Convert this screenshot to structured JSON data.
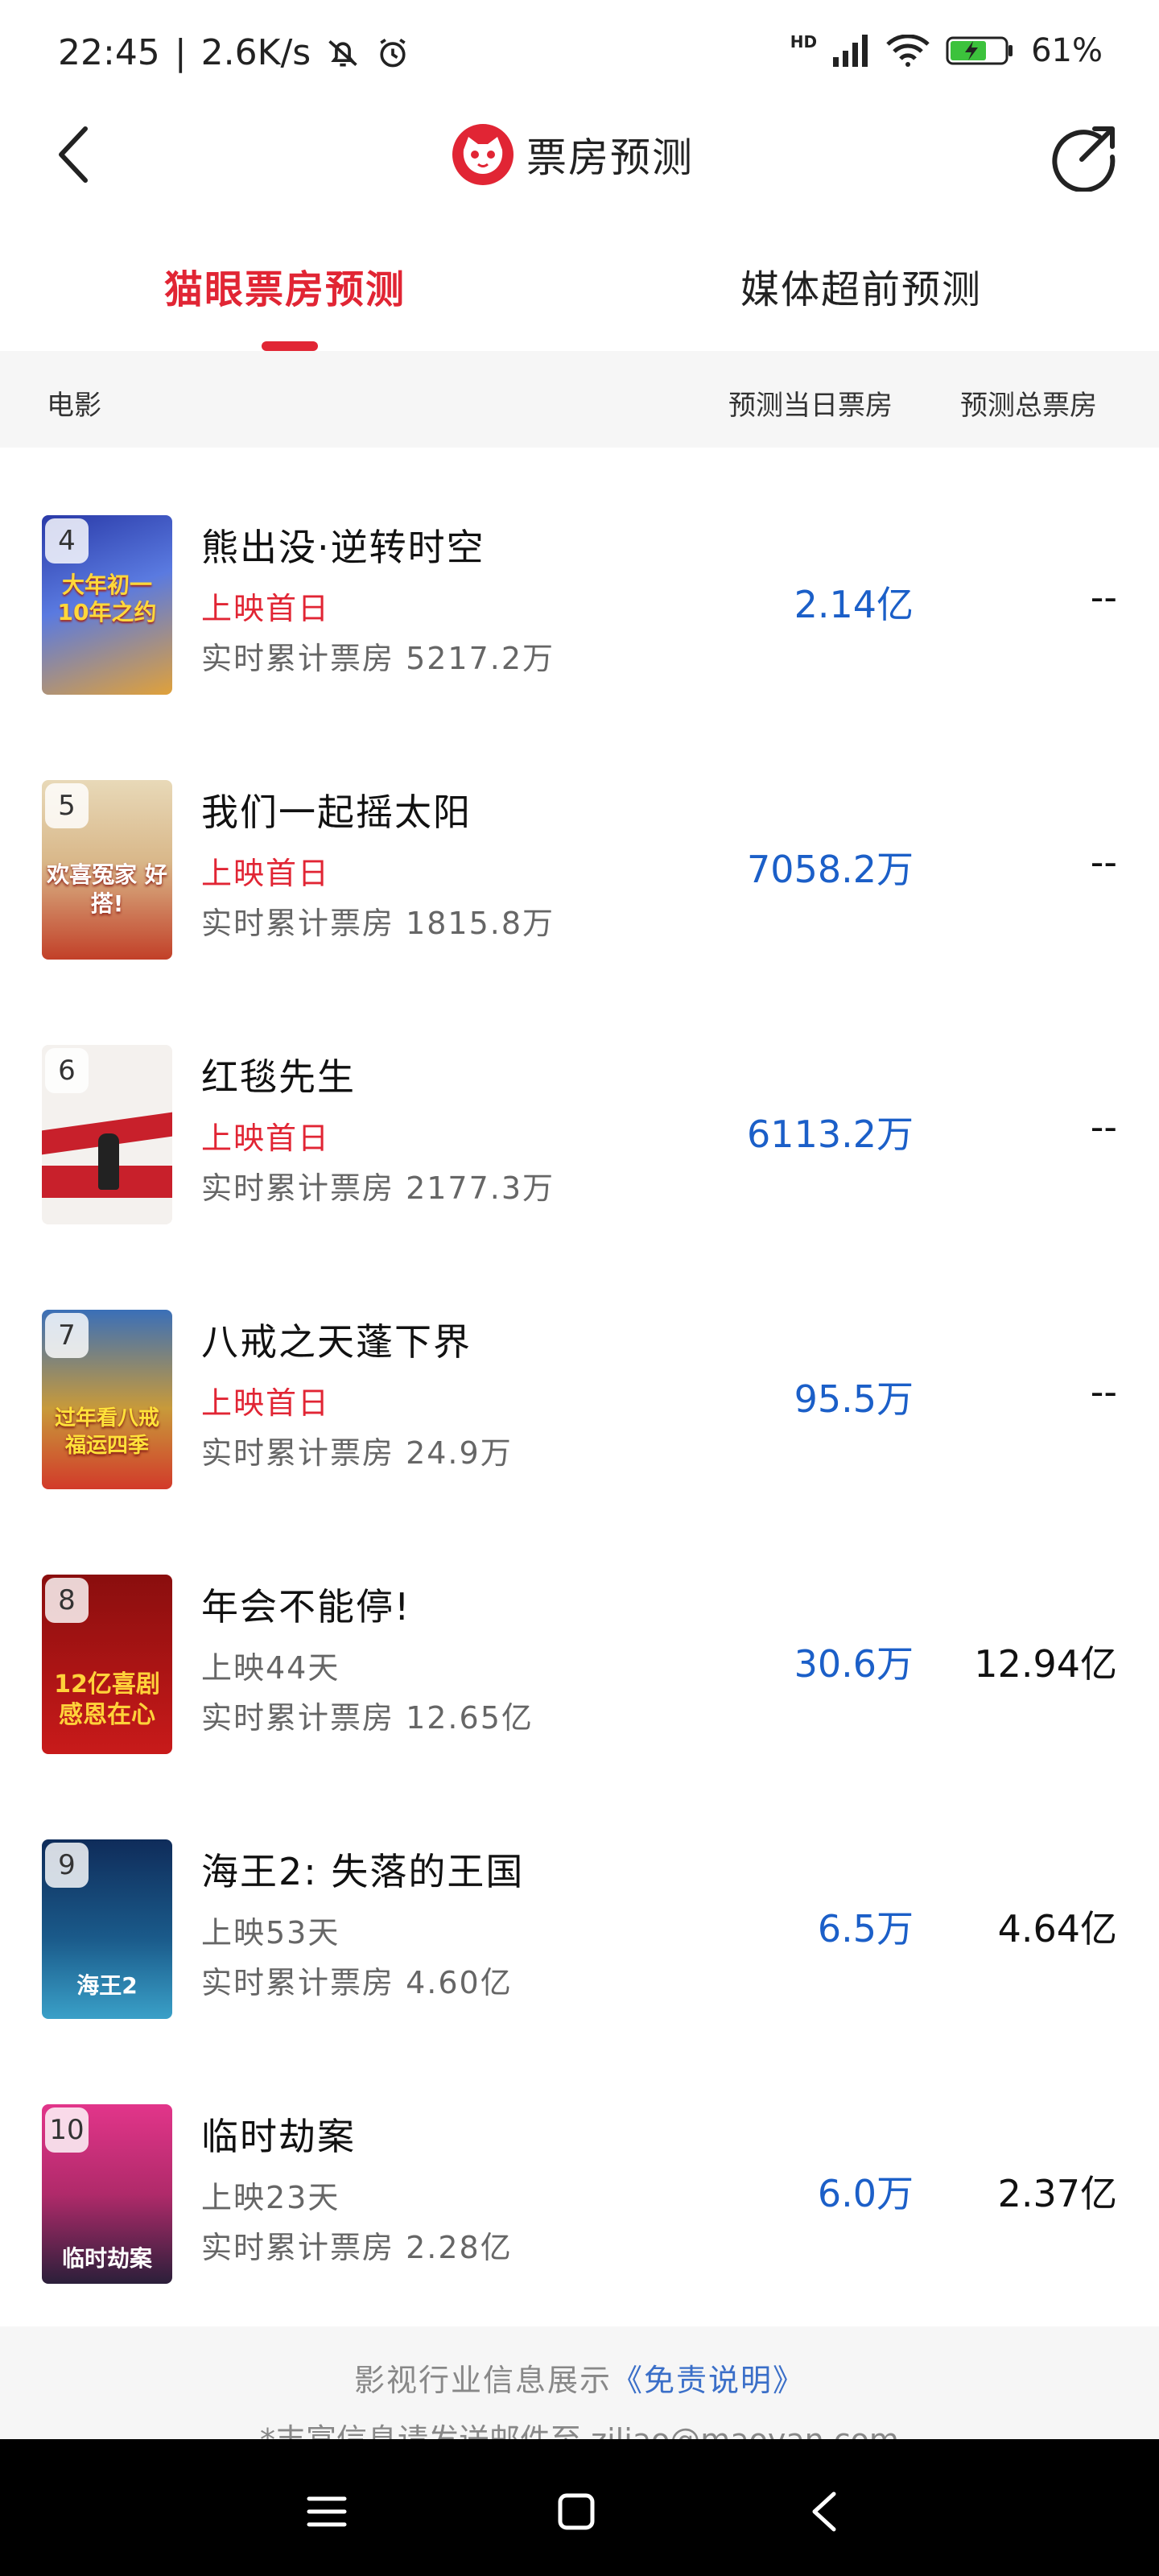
{
  "status_bar": {
    "time": "22:45",
    "divider": "|",
    "speed": "2.6K/s",
    "network": "HD",
    "battery": "61%"
  },
  "header": {
    "title": "票房预测"
  },
  "tabs": [
    {
      "label": "猫眼票房预测",
      "active": true
    },
    {
      "label": "媒体超前预测",
      "active": false
    }
  ],
  "table_header": {
    "movie": "电影",
    "day_forecast": "预测当日票房",
    "total_forecast": "预测总票房"
  },
  "movies": [
    {
      "rank": "4",
      "name": "熊出没·逆转时空",
      "release": "上映首日",
      "cumulative": "实时累计票房 5217.2万",
      "day": "2.14亿",
      "total": "--",
      "poster_colors": [
        "#2a3aa8",
        "#e0a13a"
      ]
    },
    {
      "rank": "5",
      "name": "我们一起摇太阳",
      "release": "上映首日",
      "cumulative": "实时累计票房 1815.8万",
      "day": "7058.2万",
      "total": "--",
      "poster_colors": [
        "#e8d9b8",
        "#c24028"
      ]
    },
    {
      "rank": "6",
      "name": "红毯先生",
      "release": "上映首日",
      "cumulative": "实时累计票房 2177.3万",
      "day": "6113.2万",
      "total": "--",
      "poster_colors": [
        "#f4f1ee",
        "#c8202b"
      ]
    },
    {
      "rank": "7",
      "name": "八戒之天蓬下界",
      "release": "上映首日",
      "cumulative": "实时累计票房 24.9万",
      "day": "95.5万",
      "total": "--",
      "poster_colors": [
        "#3a6fb8",
        "#d23a2a"
      ]
    },
    {
      "rank": "8",
      "name": "年会不能停!",
      "release": "上映44天",
      "cumulative": "实时累计票房 12.65亿",
      "day": "30.6万",
      "total": "12.94亿",
      "poster_colors": [
        "#b81a1a",
        "#f2d23a"
      ]
    },
    {
      "rank": "9",
      "name": "海王2: 失落的王国",
      "release": "上映53天",
      "cumulative": "实时累计票房 4.60亿",
      "day": "6.5万",
      "total": "4.64亿",
      "poster_colors": [
        "#0f2c5a",
        "#3aa0c8"
      ]
    },
    {
      "rank": "10",
      "name": "临时劫案",
      "release": "上映23天",
      "cumulative": "实时累计票房 2.28亿",
      "day": "6.0万",
      "total": "2.37亿",
      "poster_colors": [
        "#e2358a",
        "#2b1f3a"
      ]
    }
  ],
  "poster_text": {
    "p4": "大年初一 10年之约",
    "p5": "欢喜冤家 好搭!",
    "p7": "过年看八戒 福运四季",
    "p8": "12亿喜剧 感恩在心",
    "p9": "海王2",
    "p10": "临时劫案"
  },
  "footer": {
    "line1_prefix": "影视行业信息展示",
    "line1_link": "《免责说明》",
    "line2": "*丰富信息请发送邮件至 zjliao@maoyan.com"
  },
  "colors": {
    "accent": "#e12534",
    "day_value": "#1b5fc8"
  }
}
